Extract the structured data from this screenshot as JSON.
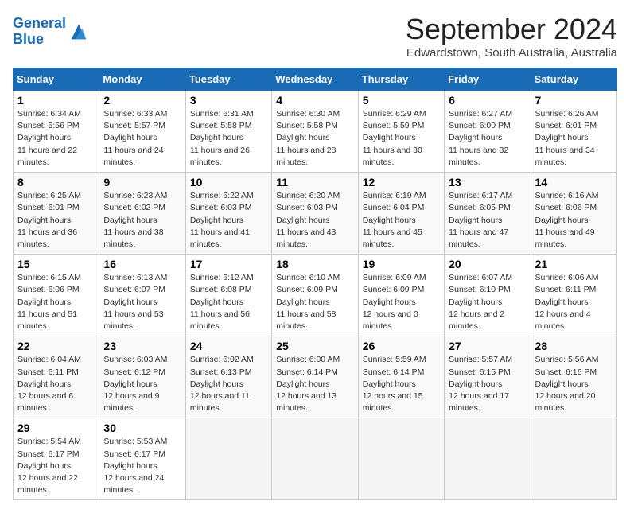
{
  "header": {
    "logo_line1": "General",
    "logo_line2": "Blue",
    "main_title": "September 2024",
    "subtitle": "Edwardstown, South Australia, Australia"
  },
  "weekdays": [
    "Sunday",
    "Monday",
    "Tuesday",
    "Wednesday",
    "Thursday",
    "Friday",
    "Saturday"
  ],
  "weeks": [
    [
      {
        "day": "1",
        "rise": "6:34 AM",
        "set": "5:56 PM",
        "hours": "11 hours and 22 minutes."
      },
      {
        "day": "2",
        "rise": "6:33 AM",
        "set": "5:57 PM",
        "hours": "11 hours and 24 minutes."
      },
      {
        "day": "3",
        "rise": "6:31 AM",
        "set": "5:58 PM",
        "hours": "11 hours and 26 minutes."
      },
      {
        "day": "4",
        "rise": "6:30 AM",
        "set": "5:58 PM",
        "hours": "11 hours and 28 minutes."
      },
      {
        "day": "5",
        "rise": "6:29 AM",
        "set": "5:59 PM",
        "hours": "11 hours and 30 minutes."
      },
      {
        "day": "6",
        "rise": "6:27 AM",
        "set": "6:00 PM",
        "hours": "11 hours and 32 minutes."
      },
      {
        "day": "7",
        "rise": "6:26 AM",
        "set": "6:01 PM",
        "hours": "11 hours and 34 minutes."
      }
    ],
    [
      {
        "day": "8",
        "rise": "6:25 AM",
        "set": "6:01 PM",
        "hours": "11 hours and 36 minutes."
      },
      {
        "day": "9",
        "rise": "6:23 AM",
        "set": "6:02 PM",
        "hours": "11 hours and 38 minutes."
      },
      {
        "day": "10",
        "rise": "6:22 AM",
        "set": "6:03 PM",
        "hours": "11 hours and 41 minutes."
      },
      {
        "day": "11",
        "rise": "6:20 AM",
        "set": "6:03 PM",
        "hours": "11 hours and 43 minutes."
      },
      {
        "day": "12",
        "rise": "6:19 AM",
        "set": "6:04 PM",
        "hours": "11 hours and 45 minutes."
      },
      {
        "day": "13",
        "rise": "6:17 AM",
        "set": "6:05 PM",
        "hours": "11 hours and 47 minutes."
      },
      {
        "day": "14",
        "rise": "6:16 AM",
        "set": "6:06 PM",
        "hours": "11 hours and 49 minutes."
      }
    ],
    [
      {
        "day": "15",
        "rise": "6:15 AM",
        "set": "6:06 PM",
        "hours": "11 hours and 51 minutes."
      },
      {
        "day": "16",
        "rise": "6:13 AM",
        "set": "6:07 PM",
        "hours": "11 hours and 53 minutes."
      },
      {
        "day": "17",
        "rise": "6:12 AM",
        "set": "6:08 PM",
        "hours": "11 hours and 56 minutes."
      },
      {
        "day": "18",
        "rise": "6:10 AM",
        "set": "6:09 PM",
        "hours": "11 hours and 58 minutes."
      },
      {
        "day": "19",
        "rise": "6:09 AM",
        "set": "6:09 PM",
        "hours": "12 hours and 0 minutes."
      },
      {
        "day": "20",
        "rise": "6:07 AM",
        "set": "6:10 PM",
        "hours": "12 hours and 2 minutes."
      },
      {
        "day": "21",
        "rise": "6:06 AM",
        "set": "6:11 PM",
        "hours": "12 hours and 4 minutes."
      }
    ],
    [
      {
        "day": "22",
        "rise": "6:04 AM",
        "set": "6:11 PM",
        "hours": "12 hours and 6 minutes."
      },
      {
        "day": "23",
        "rise": "6:03 AM",
        "set": "6:12 PM",
        "hours": "12 hours and 9 minutes."
      },
      {
        "day": "24",
        "rise": "6:02 AM",
        "set": "6:13 PM",
        "hours": "12 hours and 11 minutes."
      },
      {
        "day": "25",
        "rise": "6:00 AM",
        "set": "6:14 PM",
        "hours": "12 hours and 13 minutes."
      },
      {
        "day": "26",
        "rise": "5:59 AM",
        "set": "6:14 PM",
        "hours": "12 hours and 15 minutes."
      },
      {
        "day": "27",
        "rise": "5:57 AM",
        "set": "6:15 PM",
        "hours": "12 hours and 17 minutes."
      },
      {
        "day": "28",
        "rise": "5:56 AM",
        "set": "6:16 PM",
        "hours": "12 hours and 20 minutes."
      }
    ],
    [
      {
        "day": "29",
        "rise": "5:54 AM",
        "set": "6:17 PM",
        "hours": "12 hours and 22 minutes."
      },
      {
        "day": "30",
        "rise": "5:53 AM",
        "set": "6:17 PM",
        "hours": "12 hours and 24 minutes."
      },
      null,
      null,
      null,
      null,
      null
    ]
  ]
}
